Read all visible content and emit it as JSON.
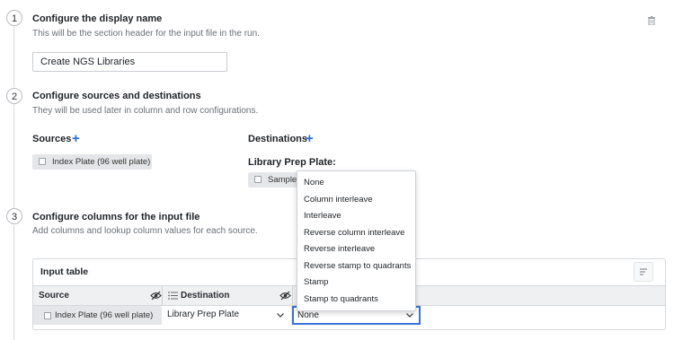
{
  "steps": [
    {
      "number": "1",
      "title": "Configure the display name",
      "description": "This will be the section header for the input file in the run."
    },
    {
      "number": "2",
      "title": "Configure sources and destinations",
      "description": "They will be used later in column and row configurations."
    },
    {
      "number": "3",
      "title": "Configure columns for the input file",
      "description": "Add columns and lookup column values for each source."
    }
  ],
  "display_name": {
    "value": "Create NGS Libraries"
  },
  "sources": {
    "label": "Sources",
    "items": [
      "Index Plate (96 well plate)"
    ]
  },
  "destinations": {
    "label": "Destinations",
    "group_label": "Library Prep Plate:",
    "items": [
      "Sample Plate"
    ]
  },
  "input_table": {
    "title": "Input table",
    "columns": [
      "Source",
      "Destination"
    ],
    "row": {
      "source": "Index Plate (96 well plate)",
      "destination": "Library Prep Plate",
      "third": "None"
    }
  },
  "dropdown": {
    "options": [
      "None",
      "Column interleave",
      "Interleave",
      "Reverse column interleave",
      "Reverse interleave",
      "Reverse stamp to quadrants",
      "Stamp",
      "Stamp to quadrants"
    ]
  },
  "colors": {
    "accent": "#2f6bd9",
    "focus_border": "#3b73d9",
    "chip_bg": "#e4e6e9",
    "header_bg": "#eef0f2"
  }
}
